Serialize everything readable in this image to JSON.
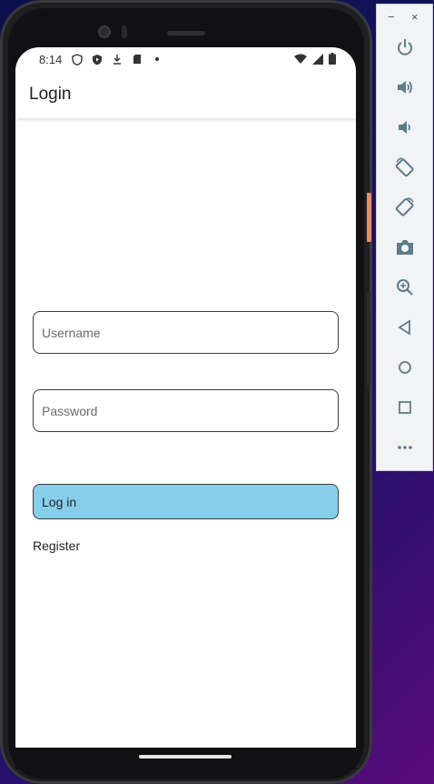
{
  "status_bar": {
    "time": "8:14"
  },
  "app_bar": {
    "title": "Login"
  },
  "form": {
    "username_placeholder": "Username",
    "password_placeholder": "Password",
    "login_label": "Log in",
    "register_label": "Register"
  },
  "toolbar": {
    "minimize_label": "−",
    "close_label": "×",
    "buttons": [
      "power-icon",
      "volume-up-icon",
      "volume-down-icon",
      "rotate-left-icon",
      "rotate-right-icon",
      "camera-icon",
      "zoom-icon",
      "back-icon",
      "home-icon",
      "overview-icon",
      "more-icon"
    ]
  },
  "colors": {
    "login_button": "#87ceeb",
    "toolbar_icon": "#5f7a8a"
  }
}
